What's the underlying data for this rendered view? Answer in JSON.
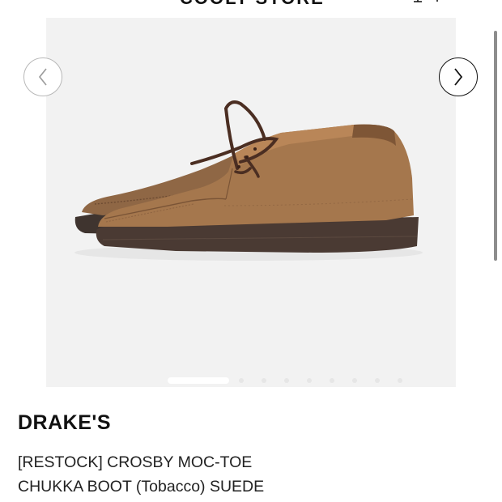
{
  "header": {
    "store_name": "COOLT STORE",
    "icons": [
      "account-icon",
      "search-icon",
      "cart-icon"
    ]
  },
  "gallery": {
    "image_subject": "boot-photo",
    "slide_count": 9,
    "active_slide": 1,
    "prev_icon": "chevron-left-icon",
    "next_icon": "chevron-right-icon"
  },
  "product": {
    "brand": "DRAKE'S",
    "title_line1": "[RESTOCK] CROSBY MOC-TOE",
    "title_line2": "CHUKKA BOOT (Tobacco) SUEDE"
  },
  "colors": {
    "background": "#ffffff",
    "gallery_bg": "#f2f2f2",
    "suede": "#a5774d",
    "sole": "#4a3a33",
    "text": "#111111"
  }
}
